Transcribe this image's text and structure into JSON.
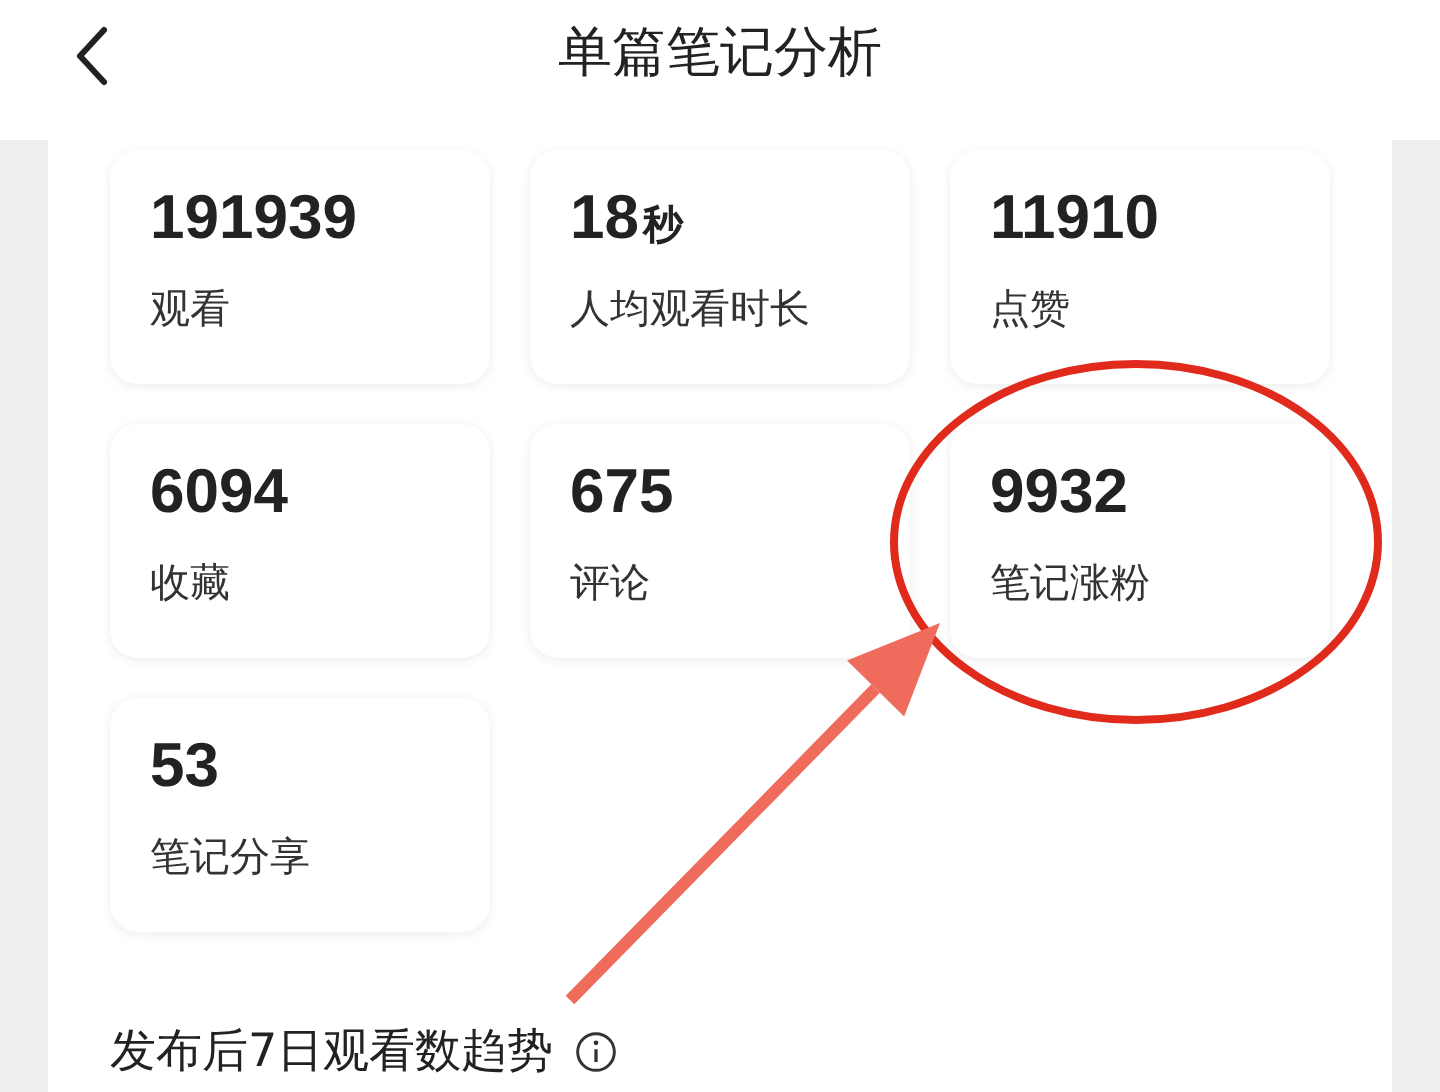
{
  "header": {
    "title": "单篇笔记分析"
  },
  "stats": [
    {
      "value": "191939",
      "label": "观看",
      "highlighted": false
    },
    {
      "value": "18",
      "unit": "秒",
      "label": "人均观看时长",
      "highlighted": false
    },
    {
      "value": "11910",
      "label": "点赞",
      "highlighted": false
    },
    {
      "value": "6094",
      "label": "收藏",
      "highlighted": false
    },
    {
      "value": "675",
      "label": "评论",
      "highlighted": false
    },
    {
      "value": "9932",
      "label": "笔记涨粉",
      "highlighted": true
    },
    {
      "value": "53",
      "label": "笔记分享",
      "highlighted": false
    }
  ],
  "section": {
    "title": "发布后7日观看数趋势"
  }
}
